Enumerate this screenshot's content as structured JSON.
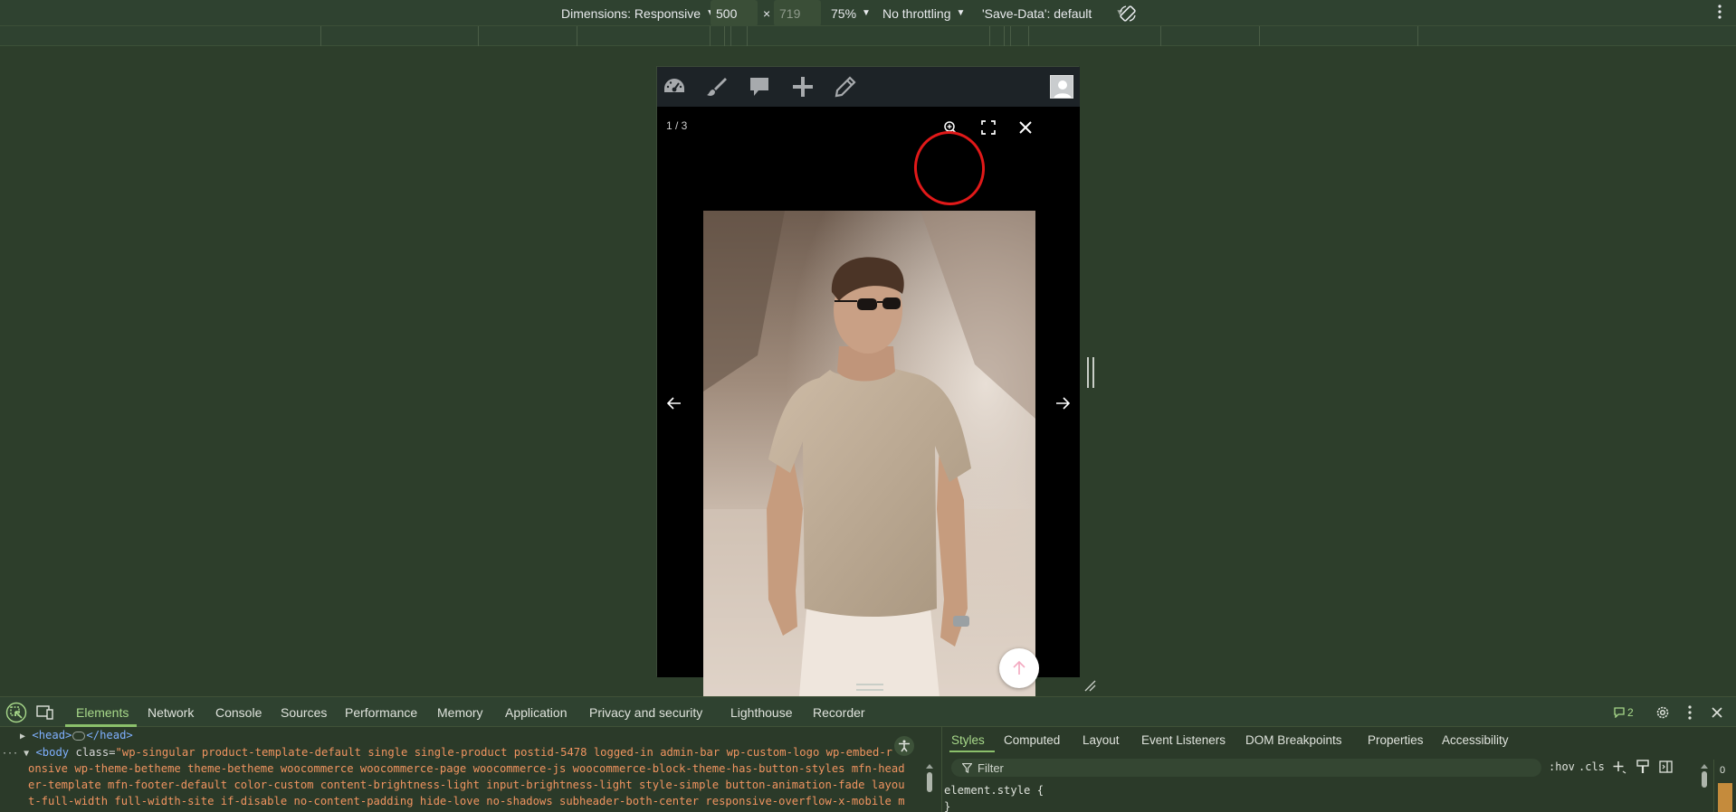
{
  "device_toolbar": {
    "dimensions_label": "Dimensions: Responsive",
    "width": "500",
    "times": "×",
    "height": "719",
    "zoom": "75%",
    "throttling": "No throttling",
    "save_data": "'Save-Data': default"
  },
  "lightbox": {
    "counter": "1 / 3"
  },
  "devtools": {
    "tabs": [
      "Elements",
      "Network",
      "Console",
      "Sources",
      "Performance",
      "Memory",
      "Application",
      "Privacy and security",
      "Lighthouse",
      "Recorder"
    ],
    "issues_count": "2",
    "elements": {
      "head_open": "<head>",
      "head_close": "</head>",
      "body_tag": "<body",
      "class_attr": " class=",
      "class_value_line1": "\"wp-singular product-template-default single single-product postid-5478 logged-in admin-bar wp-custom-logo wp-embed-r",
      "class_value_line2": "onsive wp-theme-betheme theme-betheme woocommerce woocommerce-page woocommerce-js woocommerce-block-theme-has-button-styles mfn-head",
      "class_value_line3": "er-template mfn-footer-default color-custom content-brightness-light input-brightness-light style-simple button-animation-fade layou",
      "class_value_line4": "t-full-width full-width-site if-disable no-content-padding hide-love no-shadows subheader-both-center responsive-overflow-x-mobile m"
    },
    "styles": {
      "tabs": [
        "Styles",
        "Computed",
        "Layout",
        "Event Listeners",
        "DOM Breakpoints",
        "Properties",
        "Accessibility"
      ],
      "filter_placeholder": "Filter",
      "hov": ":hov",
      "cls": ".cls",
      "rule_selector": "element.style {",
      "rule_close": "}",
      "box_number": "0"
    }
  }
}
